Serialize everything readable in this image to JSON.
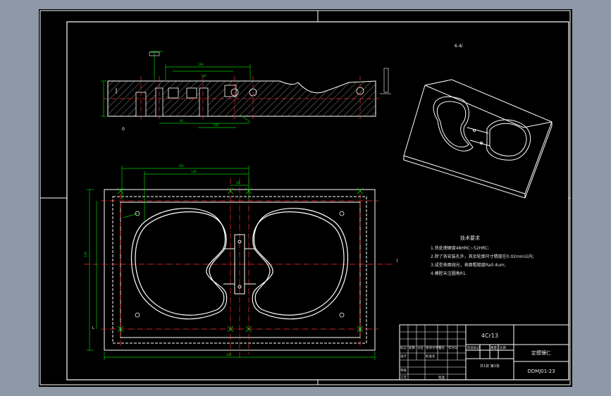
{
  "drawing": {
    "roughness_symbol": "6.4/",
    "notes_title": "技术要求",
    "notes": [
      "1.热处理硬度48HRC~52HRC;",
      "2.除了各安装孔外，其余轮廓尺寸精度在0.02mm以内;",
      "3.成型表面抛光，表面粗糙度Ra0.4um;",
      "4.模腔未注圆角R1."
    ]
  },
  "title_block": {
    "material": "4Cr13",
    "part_name": "定模镶仁",
    "drawing_no": "DDMJ01-23",
    "scale_row": "共1张  第1张",
    "cells": [
      "标记",
      "处数",
      "分区",
      "更改文件号",
      "签名",
      "年月日",
      "设计",
      "标准化",
      "阶段标记",
      "重量",
      "比例",
      "审核",
      "工艺",
      "批准"
    ]
  },
  "colors": {
    "background": "#000000",
    "frame": "#ffffff",
    "dimension": "#00cc00",
    "centerline": "#ff3030",
    "hatch": "#ffffff",
    "accent_blue": "#2e5ff0"
  }
}
